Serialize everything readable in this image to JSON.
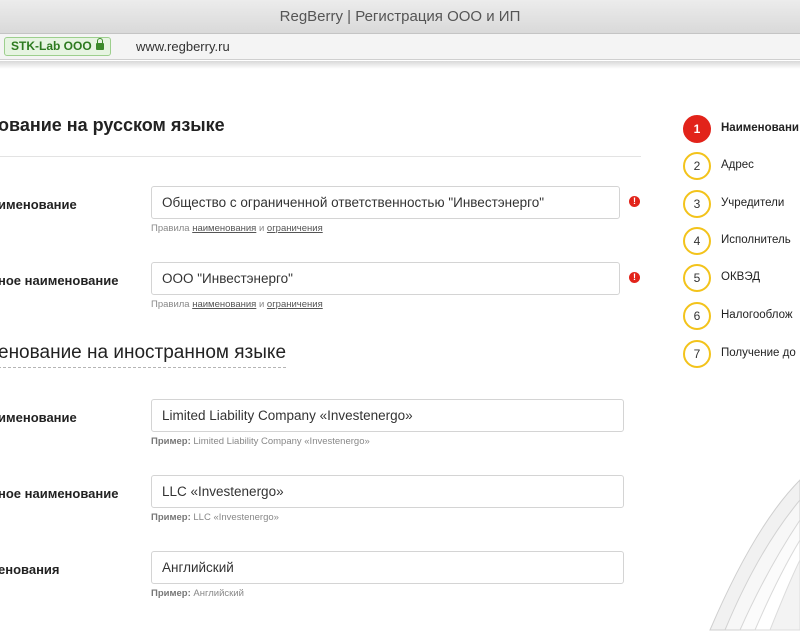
{
  "window": {
    "title": "RegBerry | Регистрация ООО и ИП"
  },
  "addressbar": {
    "ev_label": "STK-Lab OOO",
    "url": "www.regberry.ru"
  },
  "sections": {
    "russian_title": "ование на русском языке",
    "foreign_title": "енование на иностранном языке"
  },
  "fields": [
    {
      "label": "именование",
      "value": "Общество с ограниченной ответственностью \"Инвестэнерго\"",
      "hint_prefix": "Правила",
      "hint_link1": "наименования",
      "hint_and": "и",
      "hint_link2": "ограничения",
      "warning": "!"
    },
    {
      "label": "ное наименование",
      "value": "ООО \"Инвестэнерго\"",
      "hint_prefix": "Правила",
      "hint_link1": "наименования",
      "hint_and": "и",
      "hint_link2": "ограничения",
      "warning": "!"
    },
    {
      "label": "именование",
      "value": "Limited Liability Company «Investenergo»",
      "hint_example_label": "Пример:",
      "hint_example": "Limited Liability Company «Investenergo»"
    },
    {
      "label": "ное наименование",
      "value": "LLC «Investenergo»",
      "hint_example_label": "Пример:",
      "hint_example": "LLC «Investenergo»"
    },
    {
      "label": "енования",
      "value": "Английский",
      "hint_example_label": "Пример:",
      "hint_example": "Английский"
    }
  ],
  "steps": [
    {
      "num": "1",
      "label": "Наименовани"
    },
    {
      "num": "2",
      "label": "Адрес"
    },
    {
      "num": "3",
      "label": "Учредители"
    },
    {
      "num": "4",
      "label": "Исполнитель"
    },
    {
      "num": "5",
      "label": "ОКВЭД"
    },
    {
      "num": "6",
      "label": "Налогооблож"
    },
    {
      "num": "7",
      "label": "Получение до"
    }
  ],
  "colors": {
    "accent_red": "#e2231a",
    "step_yellow": "#f3c31b",
    "ev_green": "#2d7a1f"
  }
}
